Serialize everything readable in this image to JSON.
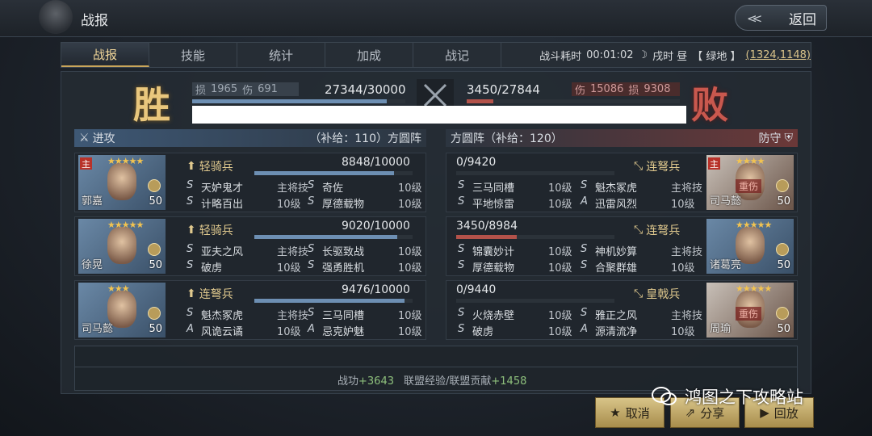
{
  "header": {
    "title": "战报",
    "back_label": "返回"
  },
  "tabs": [
    {
      "label": "战报",
      "active": true
    },
    {
      "label": "技能",
      "active": false
    },
    {
      "label": "统计",
      "active": false
    },
    {
      "label": "加成",
      "active": false
    },
    {
      "label": "战记",
      "active": false
    }
  ],
  "battle_info": {
    "duration_label": "战斗耗时",
    "duration": "00:01:02",
    "time": "戌时 昼",
    "terrain": "【 绿地 】",
    "coords": "(1324,1148)"
  },
  "summary": {
    "left": {
      "result": "胜",
      "loss_label": "损",
      "loss": "1965",
      "damage_label": "伤",
      "damage": "691",
      "troops": "27344",
      "troops_max": "30000",
      "troops_text": "27344/30000",
      "troops_fraction": 0.911
    },
    "right": {
      "result": "败",
      "damage_label": "伤",
      "damage": "15086",
      "loss_label": "损",
      "loss": "9308",
      "troops": "3450",
      "troops_max": "27844",
      "troops_text": "3450/27844",
      "troops_fraction": 0.124
    }
  },
  "attack_side": {
    "label": "进攻",
    "supply": "（补给：110）方圆阵",
    "heroes": [
      {
        "name": "郭嘉",
        "level": "50",
        "stars": "★★★★★",
        "main": "主",
        "unit": "轻骑兵",
        "hp_text": "8848/10000",
        "hp_fraction": 0.885,
        "skills": [
          {
            "grade": "S",
            "name": "天妒鬼才",
            "lvl": "主将技"
          },
          {
            "grade": "S",
            "name": "奇佐",
            "lvl": "10级"
          },
          {
            "grade": "S",
            "name": "计略百出",
            "lvl": "10级"
          },
          {
            "grade": "S",
            "name": "厚德载物",
            "lvl": "10级"
          }
        ]
      },
      {
        "name": "徐晃",
        "level": "50",
        "stars": "★★★★★",
        "unit": "轻骑兵",
        "hp_text": "9020/10000",
        "hp_fraction": 0.902,
        "skills": [
          {
            "grade": "S",
            "name": "亚夫之风",
            "lvl": "主将技"
          },
          {
            "grade": "S",
            "name": "长驱致战",
            "lvl": "10级"
          },
          {
            "grade": "S",
            "name": "破虏",
            "lvl": "10级"
          },
          {
            "grade": "S",
            "name": "强勇胜机",
            "lvl": "10级"
          }
        ]
      },
      {
        "name": "司马懿",
        "level": "50",
        "stars": "★★★",
        "unit": "连弩兵",
        "hp_text": "9476/10000",
        "hp_fraction": 0.948,
        "skills": [
          {
            "grade": "S",
            "name": "魁杰冢虎",
            "lvl": "主将技"
          },
          {
            "grade": "S",
            "name": "三马同槽",
            "lvl": "10级"
          },
          {
            "grade": "A",
            "name": "风诡云谲",
            "lvl": "10级"
          },
          {
            "grade": "A",
            "name": "忌克妒魅",
            "lvl": "10级"
          }
        ]
      }
    ]
  },
  "defend_side": {
    "label": "防守",
    "supply": "方圆阵（补给：120）",
    "heroes": [
      {
        "name": "司马懿",
        "level": "50",
        "stars": "★★★★",
        "main": "主",
        "status": "重伤",
        "unit": "连弩兵",
        "hp_text": "0/9420",
        "hp_fraction": 0,
        "skills": [
          {
            "grade": "S",
            "name": "三马同槽",
            "lvl": "10级"
          },
          {
            "grade": "S",
            "name": "魁杰冢虎",
            "lvl": "主将技"
          },
          {
            "grade": "S",
            "name": "平地惊雷",
            "lvl": "10级"
          },
          {
            "grade": "A",
            "name": "迅雷风烈",
            "lvl": "10级"
          }
        ]
      },
      {
        "name": "诸葛亮",
        "level": "50",
        "stars": "★★★★★",
        "unit": "连弩兵",
        "hp_text": "3450/8984",
        "hp_fraction": 0.384,
        "skills": [
          {
            "grade": "S",
            "name": "锦囊妙计",
            "lvl": "10级"
          },
          {
            "grade": "S",
            "name": "神机妙算",
            "lvl": "主将技"
          },
          {
            "grade": "S",
            "name": "厚德载物",
            "lvl": "10级"
          },
          {
            "grade": "S",
            "name": "合聚群雄",
            "lvl": "10级"
          }
        ]
      },
      {
        "name": "周瑜",
        "level": "50",
        "stars": "★★★★★",
        "status": "重伤",
        "unit": "皇戟兵",
        "hp_text": "0/9440",
        "hp_fraction": 0,
        "skills": [
          {
            "grade": "S",
            "name": "火烧赤壁",
            "lvl": "10级"
          },
          {
            "grade": "S",
            "name": "雅正之风",
            "lvl": "主将技"
          },
          {
            "grade": "S",
            "name": "破虏",
            "lvl": "10级"
          },
          {
            "grade": "A",
            "name": "源清流净",
            "lvl": "10级"
          }
        ]
      }
    ]
  },
  "footer": {
    "merit_label": "战功",
    "merit": "+3643",
    "alliance_label": "联盟经验/联盟贡献",
    "alliance": "+1458"
  },
  "actions": {
    "cancel": "取消",
    "share": "分享",
    "replay": "回放"
  },
  "watermark": "鸿图之下攻略站",
  "colors": {
    "win": "#e9c77d",
    "lose": "#c9584e",
    "accent": "#c9a55a"
  }
}
